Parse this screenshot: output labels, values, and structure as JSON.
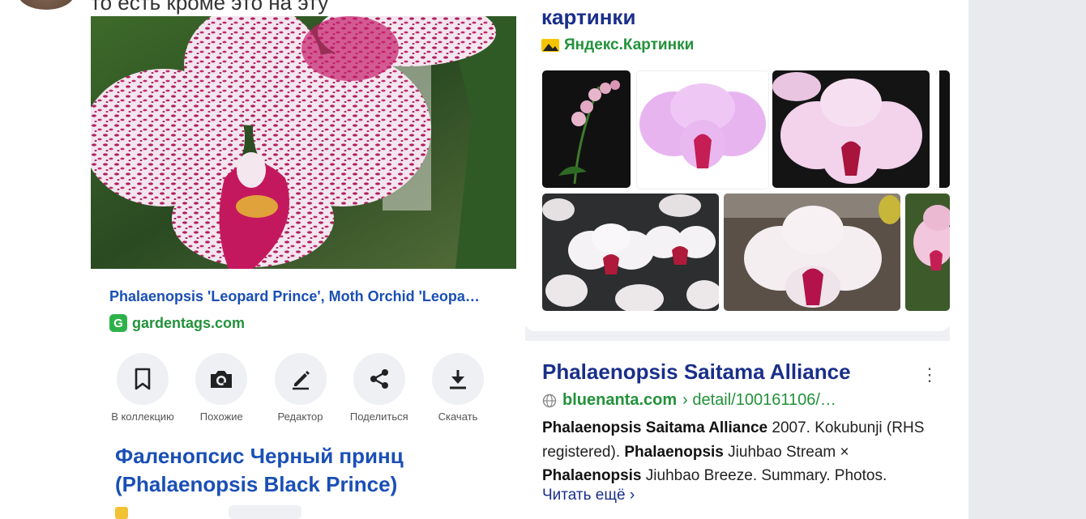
{
  "top": {
    "text": "то есть кроме это на эту"
  },
  "left_result": {
    "title": "Phalaenopsis 'Leopard Prince', Moth Orchid 'Leopa…",
    "source": "gardentags.com"
  },
  "actions": [
    {
      "label": "В коллекцию",
      "icon": "bookmark-icon"
    },
    {
      "label": "Похожие",
      "icon": "camera-icon"
    },
    {
      "label": "Редактор",
      "icon": "pencil-icon"
    },
    {
      "label": "Поделиться",
      "icon": "share-icon"
    },
    {
      "label": "Скачать",
      "icon": "download-icon"
    }
  ],
  "big_title": {
    "line1": "Фаленопсис Черный принц",
    "line2": "(Phalaenopsis Black Prince)"
  },
  "images_block": {
    "title": "картинки",
    "source": "Яндекс.Картинки"
  },
  "result2": {
    "title": "Phalaenopsis Saitama Alliance",
    "host": "bluenanta.com",
    "path": " › detail/100161106/…",
    "snippet_bold1": "Phalaenopsis Saitama Alliance",
    "snippet_text1": " 2007. Kokubunji (RHS registered). ",
    "snippet_bold2": "Phalaenopsis",
    "snippet_text2": " Jiuhbao Stream × ",
    "snippet_bold3": "Phalaenopsis",
    "snippet_text3": " Jiuhbao Breeze. Summary. Photos.",
    "read_more": "Читать ещё ›"
  },
  "colors": {
    "link_blue": "#1a4fb5",
    "title_navy": "#1a2f8a",
    "source_green": "#22923a",
    "panel_gray": "#e9eaed"
  }
}
